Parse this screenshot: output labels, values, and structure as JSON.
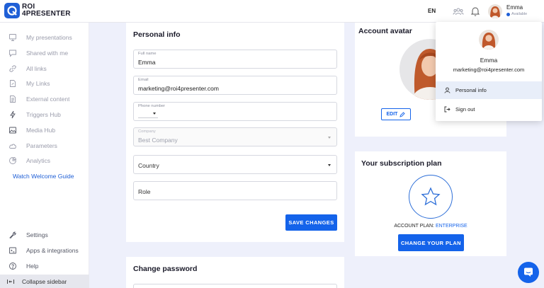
{
  "brand": {
    "line1": "ROI",
    "line2": "4PRESENTER"
  },
  "header": {
    "language": "EN",
    "user_name": "Emma",
    "user_status": "Available",
    "icons": [
      "team-icon",
      "bell-icon"
    ]
  },
  "sidebar": {
    "items": [
      {
        "label": "My presentations",
        "icon": "presentation-icon"
      },
      {
        "label": "Shared with me",
        "icon": "chat-icon"
      },
      {
        "label": "All links",
        "icon": "link-icon"
      },
      {
        "label": "My Links",
        "icon": "file-link-icon"
      },
      {
        "label": "External content",
        "icon": "document-icon"
      },
      {
        "label": "Triggers Hub",
        "icon": "lightning-icon"
      },
      {
        "label": "Media Hub",
        "icon": "image-icon"
      },
      {
        "label": "Parameters",
        "icon": "cloud-icon"
      },
      {
        "label": "Analytics",
        "icon": "analytics-icon"
      }
    ],
    "welcome_guide": "Watch Welcome Guide",
    "bottom_items": [
      {
        "label": "Settings",
        "icon": "wrench-icon"
      },
      {
        "label": "Apps & integrations",
        "icon": "terminal-icon"
      },
      {
        "label": "Help",
        "icon": "help-icon"
      }
    ],
    "collapse_label": "Collapse sidebar"
  },
  "personal_info": {
    "title": "Personal info",
    "fields": {
      "full_name": {
        "label": "Full name",
        "value": "Emma"
      },
      "email": {
        "label": "Email",
        "value": "marketing@roi4presenter.com"
      },
      "phone": {
        "label": "Phone number",
        "value": ""
      },
      "company": {
        "label": "Company",
        "value": "Best Company"
      },
      "country": {
        "placeholder": "Country"
      },
      "role": {
        "placeholder": "Role"
      }
    },
    "save_label": "SAVE CHANGES"
  },
  "change_password": {
    "title": "Change password"
  },
  "account_avatar": {
    "title": "Account avatar",
    "edit_label": "EDIT"
  },
  "subscription": {
    "title": "Your subscription plan",
    "plan_prefix": "ACCOUNT PLAN:",
    "plan_name": "ENTERPRISE",
    "change_label": "CHANGE YOUR PLAN"
  },
  "user_menu": {
    "name": "Emma",
    "email": "marketing@roi4presenter.com",
    "items": [
      {
        "label": "Personal info",
        "icon": "user-icon",
        "active": true
      },
      {
        "label": "Sign out",
        "icon": "sign-out-icon",
        "active": false
      }
    ]
  },
  "colors": {
    "accent": "#1463ea",
    "background": "#eef0fb",
    "active_menu": "#e8eef9"
  }
}
